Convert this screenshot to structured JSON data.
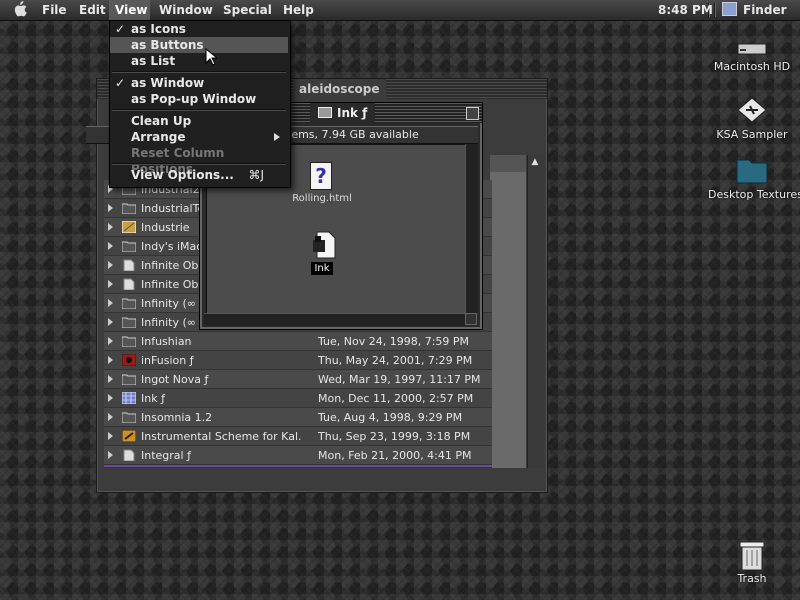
{
  "menubar": {
    "apple_icon": "apple-icon",
    "items": [
      "File",
      "Edit",
      "View",
      "Window",
      "Special",
      "Help"
    ],
    "active": "View",
    "clock": "8:48 PM",
    "app_name": "Finder",
    "app_icon": "finder-icon"
  },
  "view_menu": {
    "as_icons": "as Icons",
    "as_buttons": "as Buttons",
    "as_list": "as List",
    "as_window": "as Window",
    "as_popup_window": "as Pop-up Window",
    "clean_up": "Clean Up",
    "arrange": "Arrange",
    "reset_column_positions": "Reset Column Positions",
    "view_options": "View Options...",
    "view_options_shortcut": "⌘J",
    "checkmark": "✓",
    "highlighted": "as Buttons",
    "disabled": "Reset Column Positions"
  },
  "kaleidoscope_window": {
    "title_fragment": "aleidoscope",
    "sort_icon": "sort-direction-icon",
    "rows": [
      {
        "name": "Industrial2",
        "date": "",
        "icon": "folder-icon"
      },
      {
        "name": "IndustrialTe",
        "date": "",
        "icon": "folder-icon"
      },
      {
        "name": "Industrie",
        "date": "",
        "icon": "custom-folder-icon"
      },
      {
        "name": "Indy's iMac",
        "date": "",
        "icon": "folder-icon"
      },
      {
        "name": "Infinite Obs",
        "date": "",
        "icon": "document-icon"
      },
      {
        "name": "Infinite Obs",
        "date": "",
        "icon": "document-icon"
      },
      {
        "name": "Infinity (∞",
        "date": "",
        "icon": "folder-icon"
      },
      {
        "name": "Infinity (∞",
        "date": "",
        "icon": "folder-icon"
      },
      {
        "name": "Infushian",
        "date": "Tue, Nov 24, 1998, 7:59 PM",
        "icon": "folder-icon"
      },
      {
        "name": "inFusion ƒ",
        "date": "Thu, May 24, 2001, 7:29 PM",
        "icon": "red-folder-icon"
      },
      {
        "name": "Ingot Nova ƒ",
        "date": "Wed, Mar 19, 1997, 11:17 PM",
        "icon": "folder-icon"
      },
      {
        "name": "Ink ƒ",
        "date": "Mon, Dec 11, 2000, 2:57 PM",
        "icon": "blue-folder-icon"
      },
      {
        "name": "Insomnia 1.2",
        "date": "Tue, Aug 4, 1998, 9:29 PM",
        "icon": "folder-icon"
      },
      {
        "name": "Instrumental Scheme for Kal.",
        "date": "Thu, Sep 23, 1999, 3:18 PM",
        "icon": "scheme-icon"
      },
      {
        "name": "Integral ƒ",
        "date": "Mon, Feb 21, 2000, 4:41 PM",
        "icon": "document-icon"
      }
    ]
  },
  "ink_window": {
    "title": "Ink ƒ",
    "info": "tems, 7.94 GB available",
    "items": [
      {
        "label": "Rolling.html",
        "icon": "html-file-icon"
      },
      {
        "label": "Ink",
        "icon": "ink-document-icon"
      }
    ]
  },
  "desktop": {
    "icons": [
      {
        "label": "Macintosh HD",
        "icon": "hard-drive-icon"
      },
      {
        "label": "KSA Sampler",
        "icon": "ksa-sampler-icon"
      },
      {
        "label": "Desktop Textures",
        "icon": "folder-icon"
      },
      {
        "label": "Trash",
        "icon": "trash-icon"
      }
    ]
  }
}
